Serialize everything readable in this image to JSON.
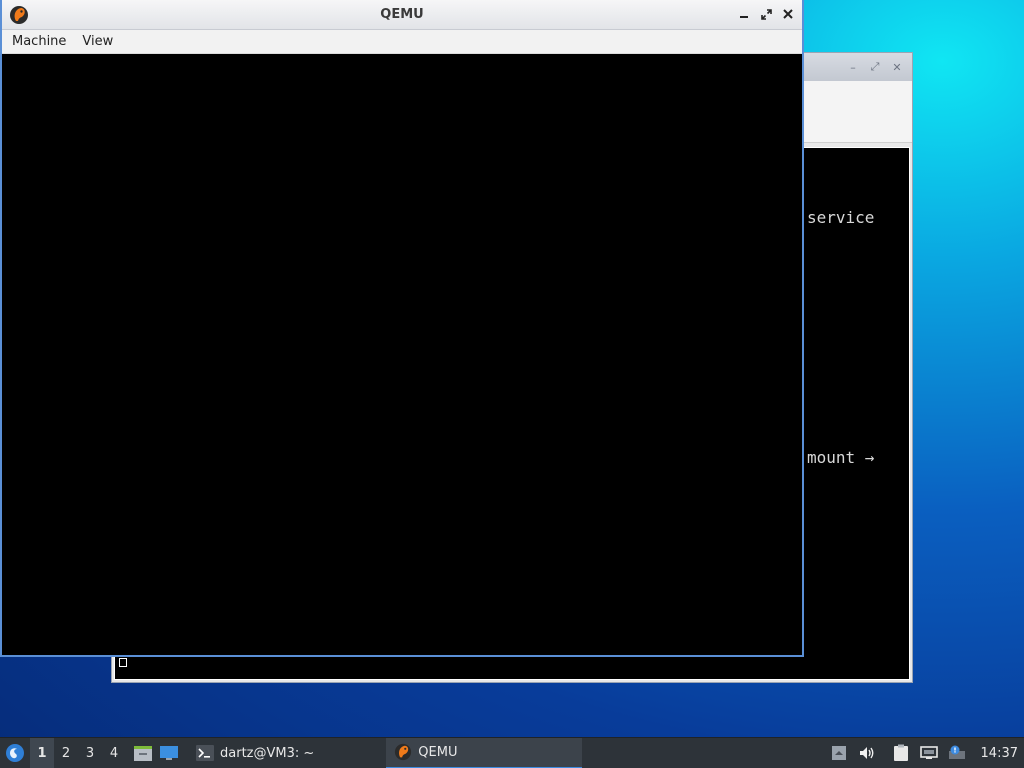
{
  "qemu": {
    "title": "QEMU",
    "menu": [
      "Machine",
      "View"
    ]
  },
  "background_terminal": {
    "lines": [
      "service",
      "mount →"
    ]
  },
  "taskbar": {
    "desktops": [
      "1",
      "2",
      "3",
      "4"
    ],
    "active_desktop": "1",
    "tasks": [
      {
        "label": "dartz@VM3: ~",
        "icon": "terminal-icon"
      },
      {
        "label": "QEMU",
        "icon": "qemu-icon",
        "active": true
      }
    ],
    "clock": "14:37"
  },
  "colors": {
    "accent": "#3d8be0",
    "taskbar_bg": "#2d3339",
    "window_border": "#5a8fd6"
  }
}
